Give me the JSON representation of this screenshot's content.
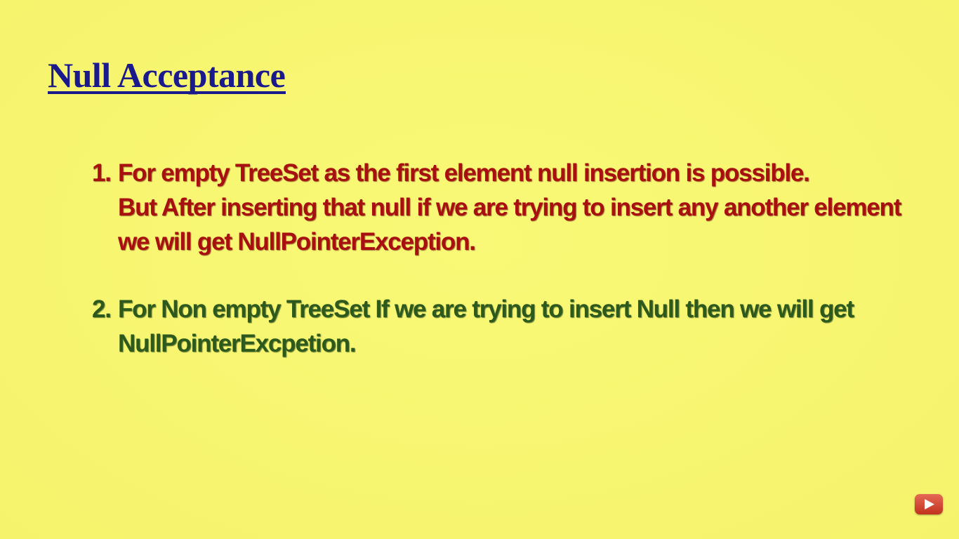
{
  "slide": {
    "title": "Null Acceptance",
    "points": [
      {
        "number": "1.",
        "lines": [
          "For empty TreeSet as the first element null insertion is possible.",
          "But After inserting that null if we are trying to insert any another element",
          "we will get NullPointerException."
        ],
        "color": "#a80f0f"
      },
      {
        "number": "2.",
        "lines": [
          "For Non empty TreeSet If we are trying to insert Null then we will get",
          "NullPointerExcpetion."
        ],
        "color": "#2d5a1c"
      }
    ],
    "title_color": "#1a1a8c",
    "background_color": "#f8f873"
  },
  "overlay": {
    "icon": "youtube-play-icon"
  }
}
